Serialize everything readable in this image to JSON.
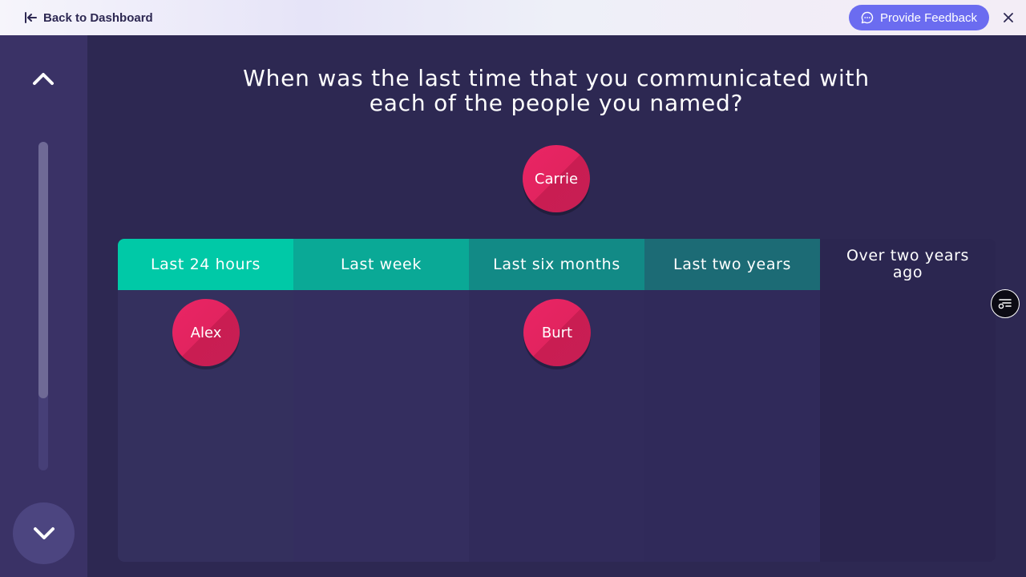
{
  "header": {
    "back_label": "Back to Dashboard",
    "feedback_label": "Provide Feedback"
  },
  "sidebar": {
    "progress": 0.78
  },
  "prompt": "When was the last time that you communicated with each of the people you named?",
  "unplaced_nodes": [
    {
      "label": "Carrie"
    }
  ],
  "columns": [
    {
      "label": "Last 24 hours",
      "header_color": "#00c9a7",
      "body_color": "#34305e",
      "nodes": [
        "Alex"
      ]
    },
    {
      "label": "Last week",
      "header_color": "#0aa996",
      "body_color": "#342e5f",
      "nodes": []
    },
    {
      "label": "Last six months",
      "header_color": "#128a86",
      "body_color": "#312b5b",
      "nodes": [
        "Burt"
      ]
    },
    {
      "label": "Last two years",
      "header_color": "#1c6b75",
      "body_color": "#302a5a",
      "nodes": []
    },
    {
      "label": "Over two years ago",
      "header_color": "#2b2650",
      "body_color": "#2b254f",
      "nodes": []
    }
  ],
  "colors": {
    "accent": "#6b6cf0",
    "node": "#e2245f",
    "background": "#2d2852"
  }
}
